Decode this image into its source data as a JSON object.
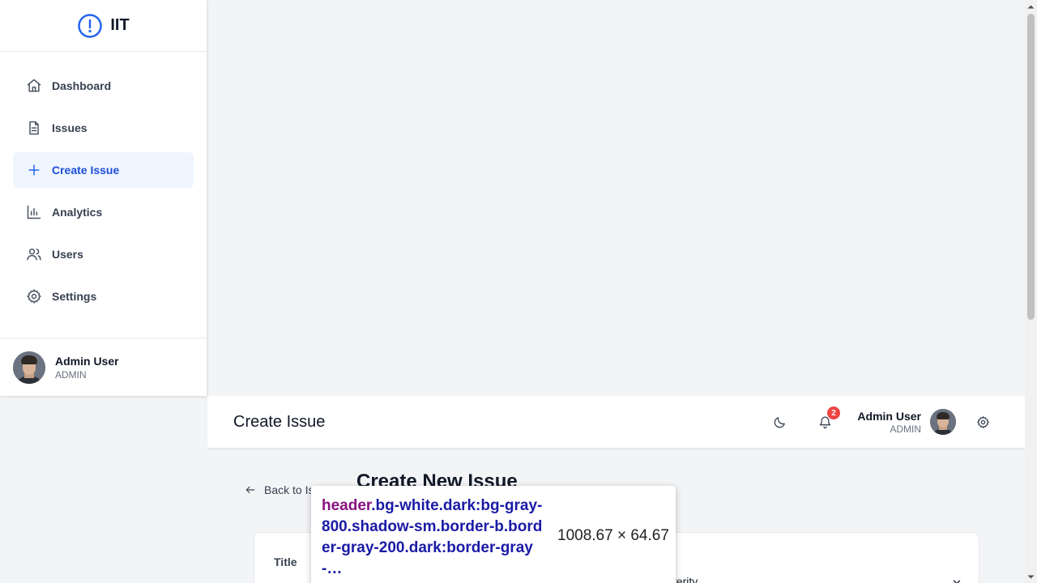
{
  "brand": {
    "name": "IIT",
    "icon": "alert-circle-icon",
    "accent": "#2563eb"
  },
  "sidebar": {
    "items": [
      {
        "label": "Dashboard",
        "icon": "home-icon",
        "active": false
      },
      {
        "label": "Issues",
        "icon": "file-text-icon",
        "active": false
      },
      {
        "label": "Create Issue",
        "icon": "plus-icon",
        "active": true
      },
      {
        "label": "Analytics",
        "icon": "bar-chart-icon",
        "active": false
      },
      {
        "label": "Users",
        "icon": "users-icon",
        "active": false
      },
      {
        "label": "Settings",
        "icon": "settings-icon",
        "active": false
      }
    ],
    "user": {
      "name": "Admin User",
      "role": "ADMIN"
    }
  },
  "header": {
    "title": "Create Issue",
    "notifications_count": "2",
    "user": {
      "name": "Admin User",
      "role": "ADMIN"
    }
  },
  "main": {
    "back_label": "Back to Is",
    "heading": "Create New Issue",
    "form": {
      "title_label": "Title",
      "severity_label": "everity"
    }
  },
  "inspector": {
    "tag": "header",
    "classes": ".bg-white.dark:bg-gray-800.shadow-sm.border-b.border-gray-200.dark:border-gray-…",
    "dimensions": "1008.67 × 64.67"
  },
  "colors": {
    "active_bg": "#eff6ff",
    "active_text": "#1d4ed8",
    "badge": "#ef4444"
  }
}
